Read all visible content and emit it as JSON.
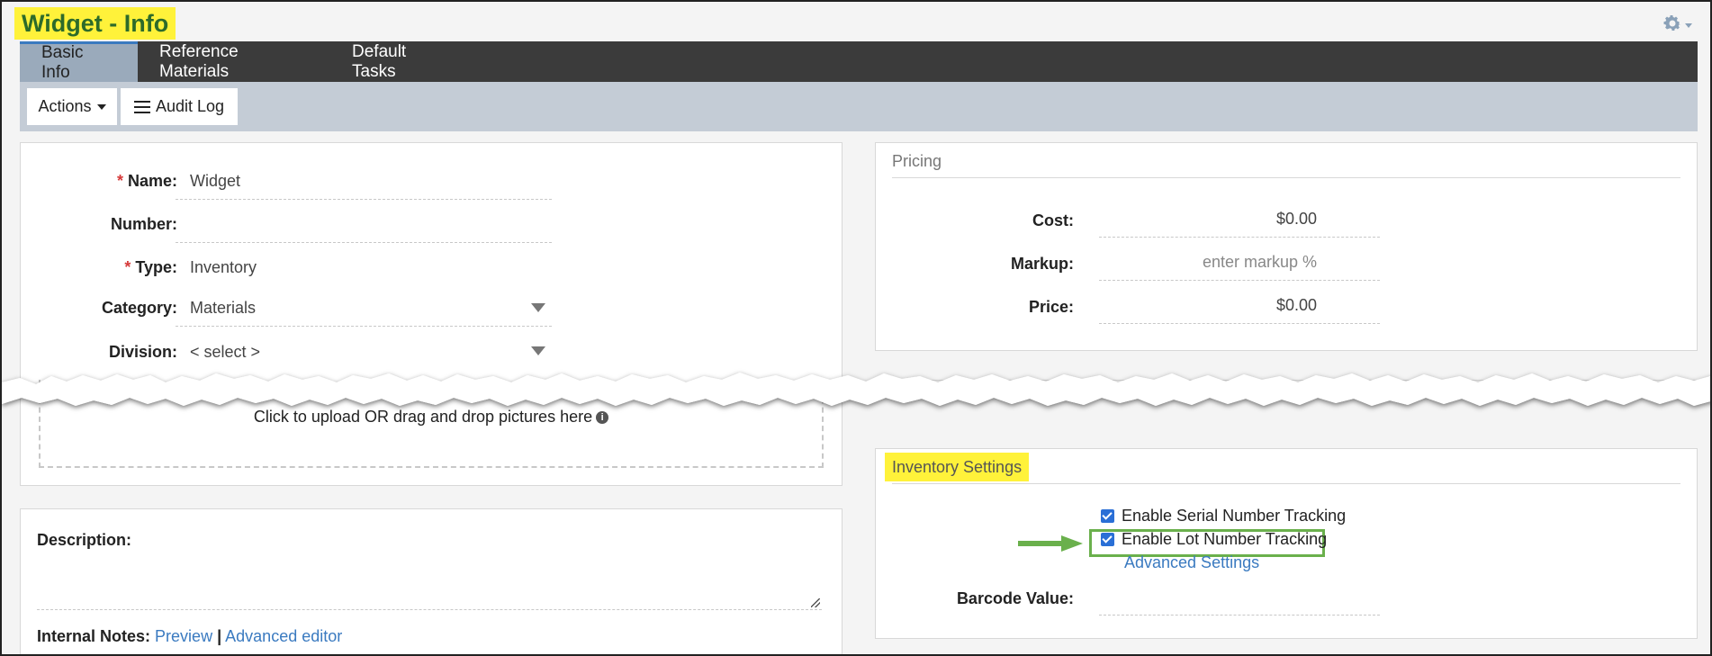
{
  "page": {
    "title": "Widget - Info"
  },
  "tabs": [
    {
      "label": "Basic Info",
      "active": true
    },
    {
      "label": "Reference Materials",
      "active": false
    },
    {
      "label": "Default Tasks",
      "active": false
    }
  ],
  "toolbar": {
    "actions_label": "Actions",
    "audit_label": "Audit Log"
  },
  "basic": {
    "name_label": "Name:",
    "name_value": "Widget",
    "number_label": "Number:",
    "number_value": "",
    "type_label": "Type:",
    "type_value": "Inventory",
    "category_label": "Category:",
    "category_value": "Materials",
    "division_label": "Division:",
    "division_value": "< select >",
    "required_mark": "*",
    "upload_text": "Click to upload OR drag and drop pictures here"
  },
  "pricing": {
    "title": "Pricing",
    "cost_label": "Cost:",
    "cost_value": "$0.00",
    "markup_label": "Markup:",
    "markup_placeholder": "enter markup %",
    "price_label": "Price:",
    "price_value": "$0.00"
  },
  "description": {
    "label": "Description:",
    "notes_label": "Internal Notes:",
    "preview_link": "Preview",
    "separator": "|",
    "advanced_editor_link": "Advanced editor"
  },
  "inventory": {
    "title": "Inventory Settings",
    "serial_label": "Enable Serial Number Tracking",
    "serial_checked": true,
    "lot_label": "Enable Lot Number Tracking",
    "lot_checked": true,
    "advanced_link": "Advanced Settings",
    "barcode_label": "Barcode Value:",
    "barcode_value": ""
  },
  "colors": {
    "highlight": "#fff23a",
    "title_green": "#2d6b2a",
    "accent_blue": "#3a7ac0",
    "arrow_green": "#6ab04c",
    "tabbar": "#3b3b3b",
    "toolbar": "#c4ccd6"
  }
}
